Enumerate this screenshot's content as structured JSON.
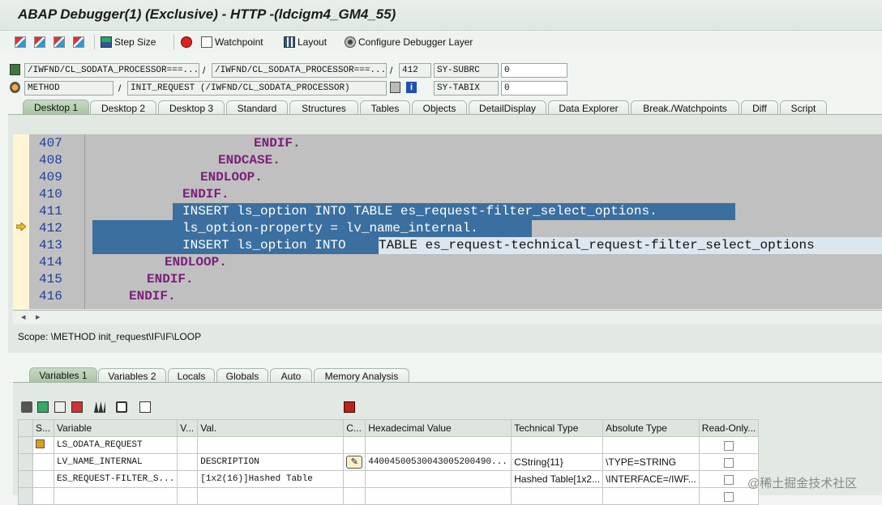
{
  "window": {
    "title": "ABAP Debugger(1)  (Exclusive) - HTTP -(ldcigm4_GM4_55)"
  },
  "toolbar": {
    "step_size": "Step Size",
    "watchpoint": "Watchpoint",
    "layout": "Layout",
    "configure": "Configure Debugger Layer"
  },
  "info": {
    "row1": {
      "program": "/IWFND/CL_SODATA_PROCESSOR===...",
      "include": "/IWFND/CL_SODATA_PROCESSOR===...",
      "line": "412",
      "var1_name": "SY-SUBRC",
      "var1_value": "0"
    },
    "row2": {
      "type": "METHOD",
      "event": "INIT_REQUEST (/IWFND/CL_SODATA_PROCESSOR)",
      "var2_name": "SY-TABIX",
      "var2_value": "0"
    },
    "slash": "/"
  },
  "desktop_tabs": [
    "Desktop 1",
    "Desktop 2",
    "Desktop 3",
    "Standard",
    "Structures",
    "Tables",
    "Objects",
    "DetailDisplay",
    "Data Explorer",
    "Break./Watchpoints",
    "Diff",
    "Script"
  ],
  "code": {
    "lines": [
      {
        "num": "407",
        "text": "ENDIF."
      },
      {
        "num": "408",
        "text": "ENDCASE."
      },
      {
        "num": "409",
        "text": "ENDLOOP."
      },
      {
        "num": "410",
        "text": "ENDIF."
      },
      {
        "num": "411",
        "text": "INSERT ls_option INTO TABLE es_request-filter_select_options."
      },
      {
        "num": "412",
        "text": "ls_option-property = lv_name_internal."
      },
      {
        "num": "413a",
        "text": "INSERT ls_option INTO "
      },
      {
        "num": "413b",
        "text": "TABLE es_request-technical_request-filter_select_options"
      },
      {
        "num": "414",
        "text": "ENDLOOP."
      },
      {
        "num": "415",
        "text": "ENDIF."
      },
      {
        "num": "416",
        "text": "ENDIF."
      }
    ],
    "numbers": [
      "407",
      "408",
      "409",
      "410",
      "411",
      "412",
      "413",
      "414",
      "415",
      "416"
    ]
  },
  "scope": "Scope: \\METHOD init_request\\IF\\IF\\LOOP",
  "var_tabs": [
    "Variables 1",
    "Variables 2",
    "Locals",
    "Globals",
    "Auto",
    "Memory Analysis"
  ],
  "grid": {
    "headers": [
      "S...",
      "Variable",
      "V...",
      "Val.",
      "C...",
      "Hexadecimal Value",
      "Technical Type",
      "Absolute Type",
      "Read-Only..."
    ],
    "rows": [
      {
        "var": "LS_ODATA_REQUEST",
        "val": "",
        "hex": "",
        "tech": "",
        "abs": ""
      },
      {
        "var": "LV_NAME_INTERNAL",
        "val": "DESCRIPTION",
        "hex": "44004500530043005200490...",
        "tech": "CString{11}",
        "abs": "\\TYPE=STRING"
      },
      {
        "var": "ES_REQUEST-FILTER_S...",
        "val": "[1x2(16)]Hashed Table",
        "hex": "",
        "tech": "Hashed Table[1x2...",
        "abs": "\\INTERFACE=/IWF..."
      },
      {
        "var": "",
        "val": "",
        "hex": "",
        "tech": "",
        "abs": ""
      }
    ]
  },
  "watermark": "@稀土掘金技术社区",
  "colors": {
    "highlight": "#3a6f9f",
    "keyword": "#7a1f7a",
    "linenum": "#1f3f99",
    "active_tab": "#b5ceb0"
  }
}
